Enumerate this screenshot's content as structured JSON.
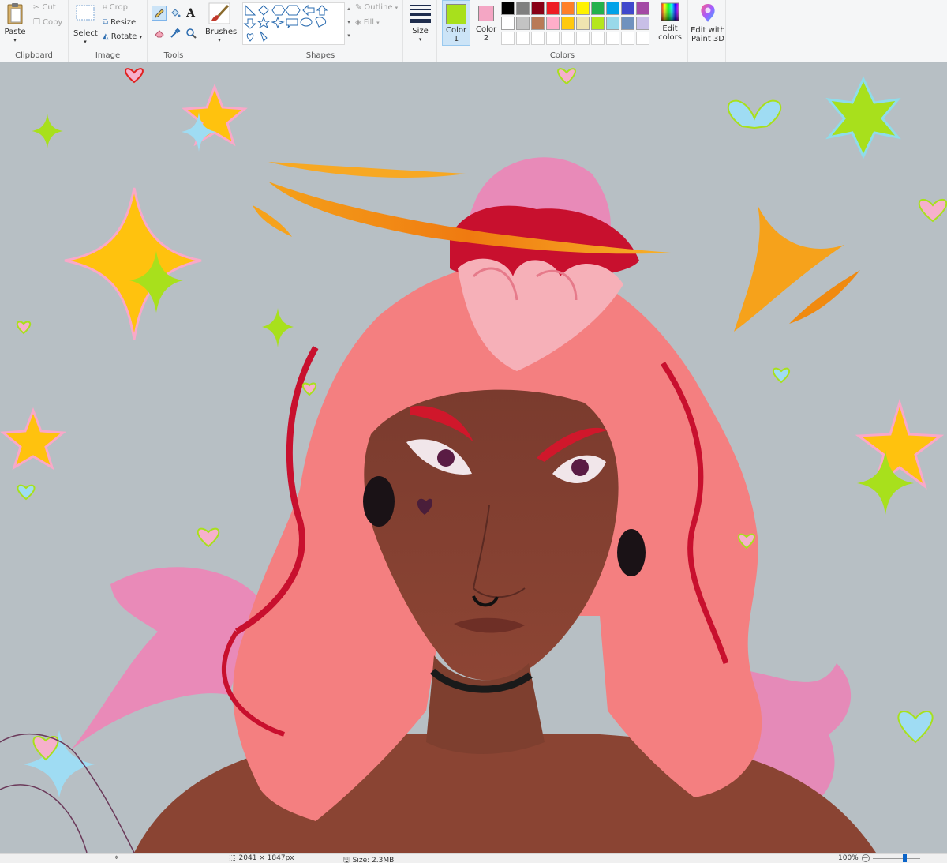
{
  "ribbon": {
    "clipboard": {
      "label": "Clipboard",
      "paste": "Paste",
      "cut": "Cut",
      "copy": "Copy"
    },
    "image": {
      "label": "Image",
      "select": "Select",
      "crop": "Crop",
      "resize": "Resize",
      "rotate": "Rotate"
    },
    "tools": {
      "label": "Tools"
    },
    "brushes": {
      "label": "Brushes"
    },
    "shapes": {
      "label": "Shapes",
      "outline": "Outline",
      "fill": "Fill"
    },
    "size": {
      "label": "Size"
    },
    "colors": {
      "label": "Colors",
      "color1": "Color 1",
      "color2": "Color 2",
      "edit_colors": "Edit colors",
      "color1_value": "#a8e01c",
      "color2_value": "#f4a6c4",
      "palette_row1": [
        "#000000",
        "#7f7f7f",
        "#880015",
        "#ed1c24",
        "#ff7f27",
        "#fff200",
        "#22b14c",
        "#00a2e8",
        "#3f48cc",
        "#a349a4"
      ],
      "palette_row2": [
        "#ffffff",
        "#c3c3c3",
        "#b97a57",
        "#ffaec9",
        "#ffc90e",
        "#efe4b0",
        "#b5e61d",
        "#99d9ea",
        "#7092be",
        "#c8bfe7"
      ]
    },
    "paint3d": {
      "label": "Edit with Paint 3D"
    }
  },
  "statusbar": {
    "dimensions": "2041 × 1847px",
    "size": "Size: 2.3MB",
    "zoom": "100%"
  },
  "colors": {
    "canvas_bg": "#b7bfc4",
    "hair": "#f47f80",
    "hair_pink": "#e58ab8",
    "skin": "#8c4a34",
    "halo": "#f6a21b"
  }
}
